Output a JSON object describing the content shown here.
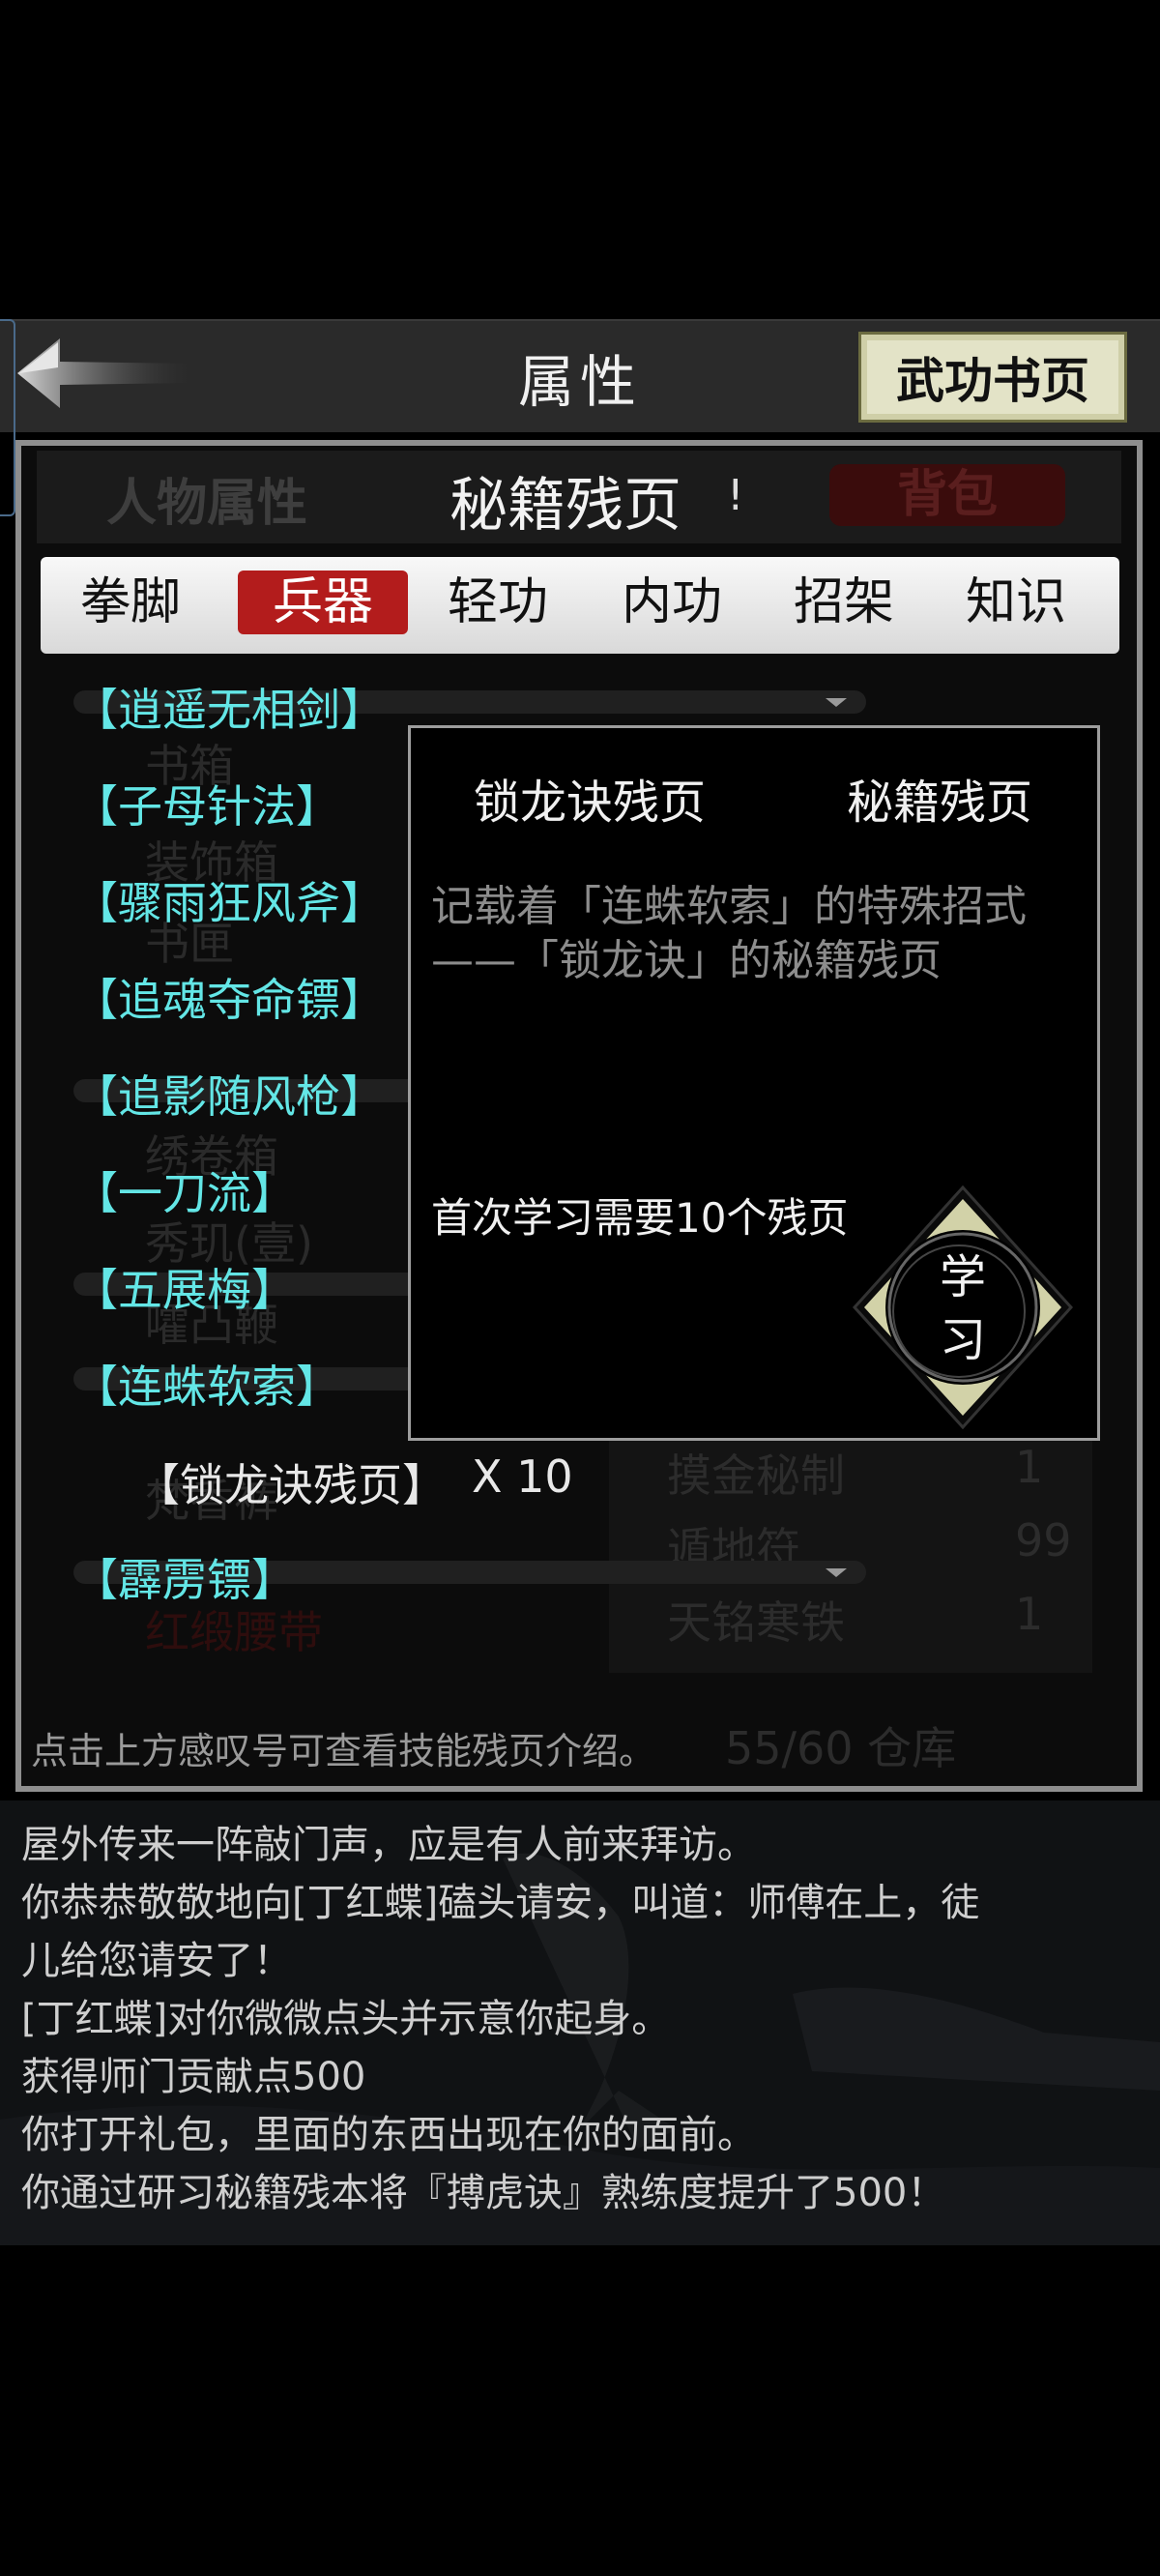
{
  "header": {
    "title": "属性",
    "skillbook_button": "武功书页"
  },
  "subtabs": {
    "character": "人物属性",
    "pages": "秘籍残页",
    "alert": "!",
    "bag": "背包"
  },
  "categories": [
    "拳脚",
    "兵器",
    "轻功",
    "内功",
    "招架",
    "知识"
  ],
  "active_category": "兵器",
  "skills": [
    "【逍遥无相剑】",
    "【子母针法】",
    "【骤雨狂风斧】",
    "【追魂夺命镖】",
    "【追影随风枪】",
    "【一刀流】",
    "【五展梅】",
    "【连蛛软索】",
    "【霹雳镖】"
  ],
  "fragment": {
    "name": "【锁龙诀残页】",
    "count": "X 10"
  },
  "popup": {
    "item_name": "锁龙诀残页",
    "item_type": "秘籍残页",
    "description": "记载着「连蛛软索」的特殊招式——「锁龙诀」的秘籍残页",
    "requirement": "首次学习需要10个残页",
    "learn_top": "学",
    "learn_bottom": "习"
  },
  "background_ghost": {
    "list": [
      "书箱",
      "装饰箱",
      "书匣",
      "绣卷箱",
      "秀玑(壹)",
      "嚯凸鞭",
      "梵香裤",
      "红缎腰带"
    ],
    "store": [
      [
        "摸金秘制",
        "1"
      ],
      [
        "遁地符",
        "99"
      ],
      [
        "天铭寒铁",
        "1"
      ]
    ],
    "counter": "55/60 仓库"
  },
  "hint": "点击上方感叹号可查看技能残页介绍。",
  "log": [
    "屋外传来一阵敲门声，应是有人前来拜访。",
    "你恭恭敬敬地向[丁红蝶]磕头请安，叫道：师傅在上，徒",
    "儿给您请安了！",
    "[丁红蝶]对你微微点头并示意你起身。",
    "获得师门贡献点500",
    "你打开礼包，里面的东西出现在你的面前。",
    "你通过研习秘籍残本将『搏虎诀』熟练度提升了500！"
  ],
  "colors": {
    "accent_red": "#b31c1c",
    "skill_cyan": "#63e6e6",
    "button_khaki": "#e3e3c7"
  },
  "icons": {
    "back": "back-arrow-icon",
    "learn": "diamond-learn-icon"
  }
}
